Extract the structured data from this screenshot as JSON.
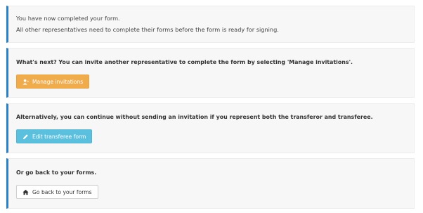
{
  "status_panel": {
    "line1": "You have now completed your form.",
    "line2": "All other representatives need to complete their forms before the form is ready for signing."
  },
  "invite_panel": {
    "text": "What's next? You can invite another representative to complete the form by selecting 'Manage invitations'.",
    "button_label": "Manage invitations",
    "button_icon": "user-plus-icon"
  },
  "edit_panel": {
    "text": "Alternatively, you can continue without sending an invitation if you represent both the transferor and transferee.",
    "button_label": "Edit transferee form",
    "button_icon": "pencil-icon"
  },
  "back_panel": {
    "text": "Or go back to your forms.",
    "button_label": "Go back to your forms",
    "button_icon": "home-icon"
  },
  "colors": {
    "accent_border": "#2a80c6",
    "panel_bg": "#f7f7f7",
    "manage_button": "#f0ac4c",
    "edit_button": "#5bc0de",
    "back_button": "#ffffff"
  }
}
